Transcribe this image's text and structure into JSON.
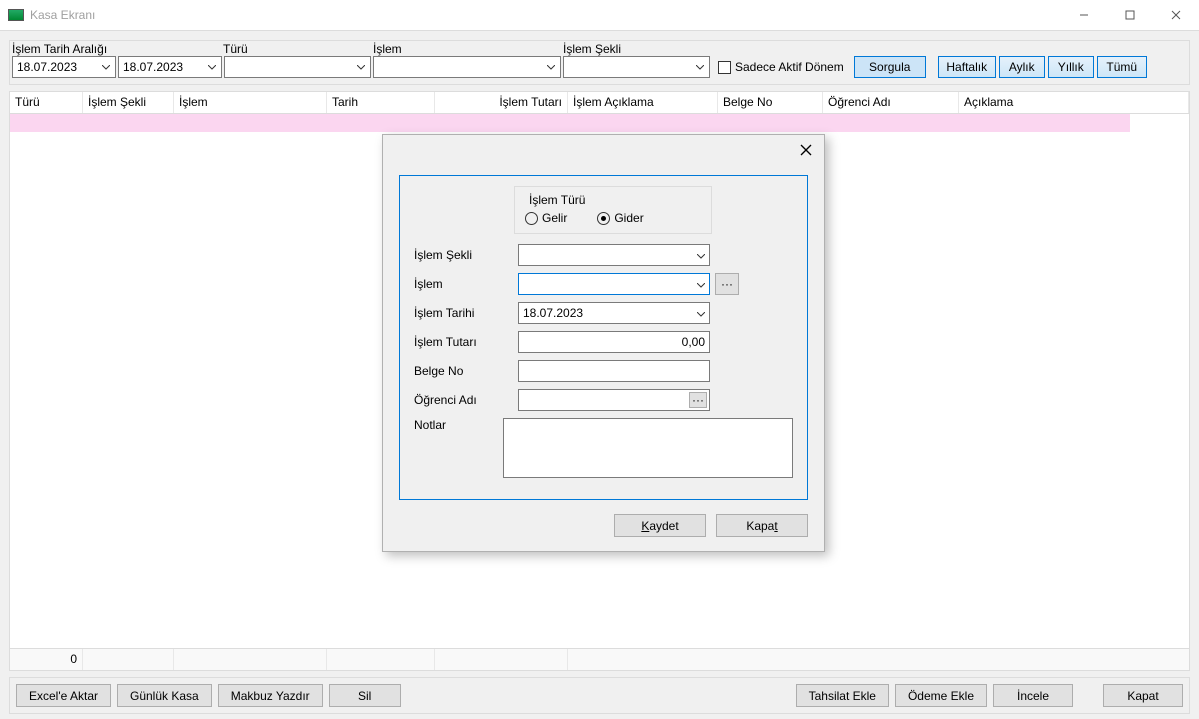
{
  "window": {
    "title": "Kasa Ekranı"
  },
  "filters": {
    "date_range_label": "İşlem Tarih Aralığı",
    "date_from": "18.07.2023",
    "date_to": "18.07.2023",
    "type_label": "Türü",
    "type_value": "",
    "op_label": "İşlem",
    "op_value": "",
    "method_label": "İşlem Şekli",
    "method_value": "",
    "only_active_label": "Sadece Aktif Dönem",
    "query_btn": "Sorgula",
    "weekly_btn": "Haftalık",
    "monthly_btn": "Aylık",
    "yearly_btn": "Yıllık",
    "all_btn": "Tümü"
  },
  "grid": {
    "cols": [
      "Türü",
      "İşlem Şekli",
      "İşlem",
      "Tarih",
      "İşlem Tutarı",
      "İşlem Açıklama",
      "Belge No",
      "Öğrenci Adı",
      "Açıklama"
    ],
    "footer_total": "0"
  },
  "footer": {
    "excel": "Excel'e Aktar",
    "daily": "Günlük Kasa",
    "receipt": "Makbuz Yazdır",
    "delete": "Sil",
    "add_collect": "Tahsilat Ekle",
    "add_pay": "Ödeme Ekle",
    "inspect": "İncele",
    "close": "Kapat"
  },
  "dialog": {
    "group_title": "İşlem Türü",
    "radio_income": "Gelir",
    "radio_expense": "Gider",
    "method_label": "İşlem Şekli",
    "method_value": "",
    "op_label": "İşlem",
    "op_value": "",
    "op_more": "···",
    "date_label": "İşlem Tarihi",
    "date_value": "18.07.2023",
    "amount_label": "İşlem Tutarı",
    "amount_value": "0,00",
    "docno_label": "Belge No",
    "docno_value": "",
    "student_label": "Öğrenci Adı",
    "student_value": "",
    "student_more": "···",
    "notes_label": "Notlar",
    "notes_value": "",
    "save_btn_u": "K",
    "save_btn_rest": "aydet",
    "close_btn_u": "t",
    "close_btn_pre": "Kapa"
  }
}
